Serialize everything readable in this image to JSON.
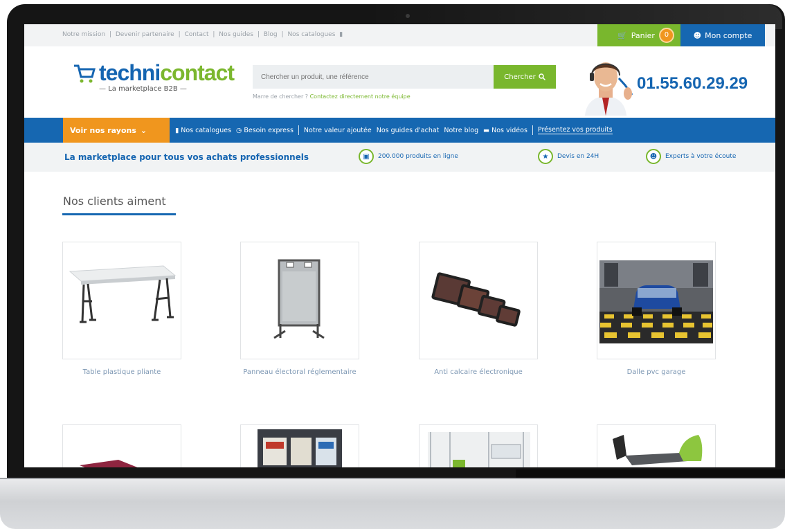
{
  "topbar": {
    "links": [
      "Notre mission",
      "Devenir partenaire",
      "Contact",
      "Nos guides",
      "Blog",
      "Nos catalogues"
    ],
    "separator": "|",
    "cart_label": "Panier",
    "cart_count": "0",
    "account_label": "Mon compte"
  },
  "header": {
    "logo_part1": "techni",
    "logo_part2": "contact",
    "logo_sub": "La marketplace B2B",
    "search_placeholder": "Chercher un produit, une référence",
    "search_button": "Chercher",
    "search_hint": "Marre de chercher ? ",
    "search_hint_link": "Contactez directement notre équipe",
    "phone": "01.55.60.29.29"
  },
  "mainnav": {
    "rayons_label": "Voir nos rayons",
    "items": [
      "Nos catalogues",
      "Besoin express",
      "Notre valeur ajoutée",
      "Nos guides d'achat",
      "Notre blog",
      "Nos vidéos",
      "Présentez vos produits"
    ]
  },
  "valuebar": {
    "tagline": "La marketplace pour tous vos achats professionnels",
    "features": [
      "200.000 produits en ligne",
      "Devis en 24H",
      "Experts à votre écoute"
    ]
  },
  "section": {
    "title": "Nos clients aiment"
  },
  "products": [
    {
      "name": "Table plastique pliante",
      "icon": "folding-table"
    },
    {
      "name": "Panneau électoral réglementaire",
      "icon": "election-panel"
    },
    {
      "name": "Anti calcaire électronique",
      "icon": "anti-limescale-device"
    },
    {
      "name": "Dalle pvc garage",
      "icon": "garage-floor-tile"
    }
  ],
  "colors": {
    "brand_blue": "#1667b1",
    "brand_green": "#79b72d",
    "accent_orange": "#f0961e"
  }
}
